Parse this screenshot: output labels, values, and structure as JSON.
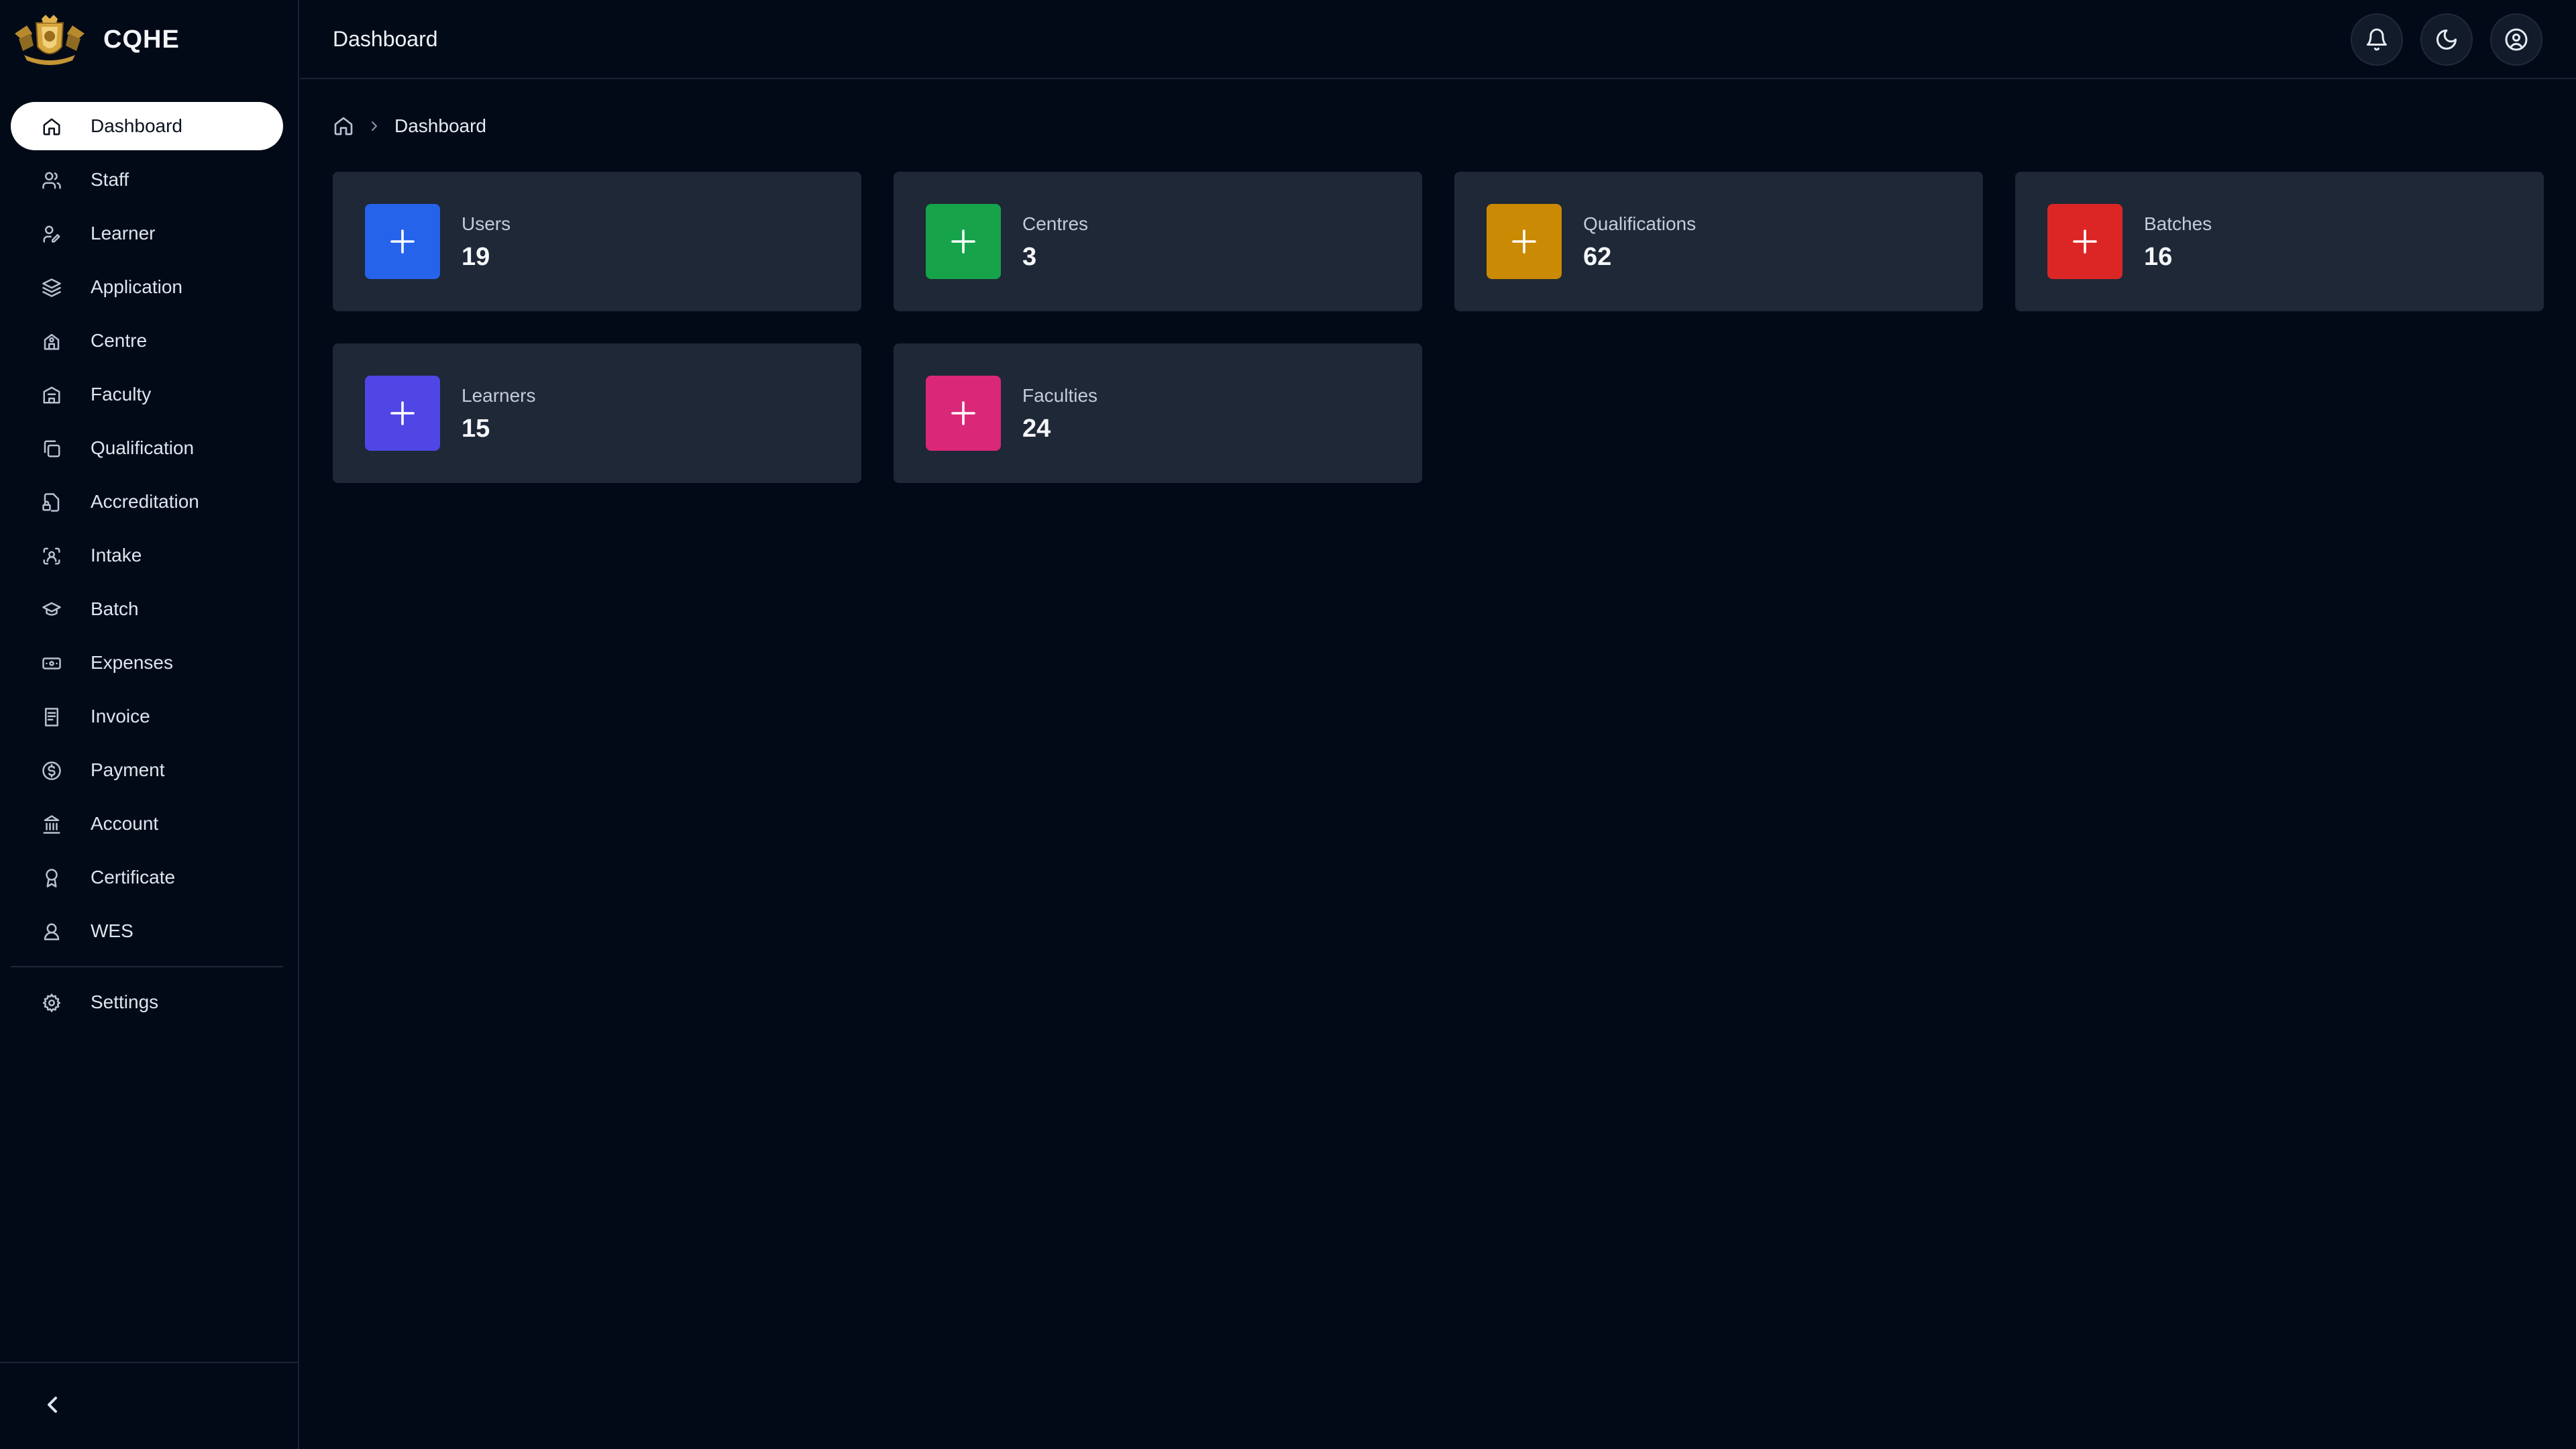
{
  "brand": {
    "name": "CQHE"
  },
  "header": {
    "title": "Dashboard"
  },
  "breadcrumb": {
    "current": "Dashboard"
  },
  "sidebar": {
    "items": [
      {
        "label": "Dashboard",
        "icon": "home-icon",
        "active": true
      },
      {
        "label": "Staff",
        "icon": "users-icon"
      },
      {
        "label": "Learner",
        "icon": "user-pen-icon"
      },
      {
        "label": "Application",
        "icon": "layers-icon"
      },
      {
        "label": "Centre",
        "icon": "school-icon"
      },
      {
        "label": "Faculty",
        "icon": "building-icon"
      },
      {
        "label": "Qualification",
        "icon": "copy-icon"
      },
      {
        "label": "Accreditation",
        "icon": "file-lock-icon"
      },
      {
        "label": "Intake",
        "icon": "scan-face-icon"
      },
      {
        "label": "Batch",
        "icon": "graduation-cap-icon"
      },
      {
        "label": "Expenses",
        "icon": "banknote-icon"
      },
      {
        "label": "Invoice",
        "icon": "receipt-icon"
      },
      {
        "label": "Payment",
        "icon": "dollar-circle-icon"
      },
      {
        "label": "Account",
        "icon": "landmark-icon"
      },
      {
        "label": "Certificate",
        "icon": "award-icon"
      },
      {
        "label": "WES",
        "icon": "user-badge-icon"
      }
    ],
    "settings": {
      "label": "Settings",
      "icon": "gear-icon"
    }
  },
  "stats": [
    {
      "label": "Users",
      "value": "19",
      "color": "#2563eb"
    },
    {
      "label": "Centres",
      "value": "3",
      "color": "#16a34a"
    },
    {
      "label": "Qualifications",
      "value": "62",
      "color": "#ca8a04"
    },
    {
      "label": "Batches",
      "value": "16",
      "color": "#dc2626"
    },
    {
      "label": "Learners",
      "value": "15",
      "color": "#4f46e5"
    },
    {
      "label": "Faculties",
      "value": "24",
      "color": "#db2777"
    }
  ],
  "theme": {
    "background": "#030a17",
    "card": "#1e2836"
  }
}
